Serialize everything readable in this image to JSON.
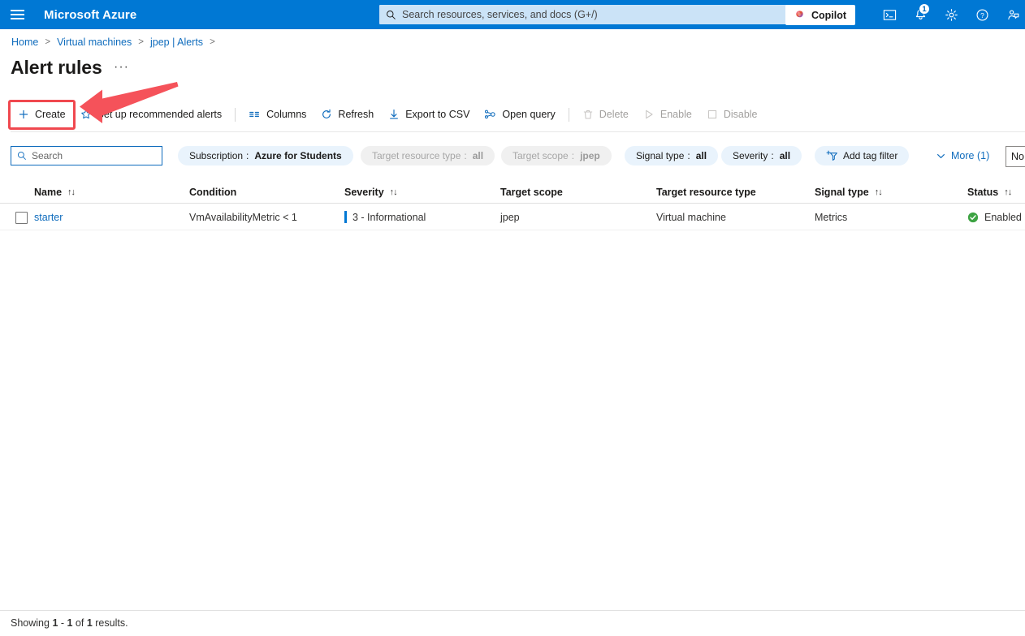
{
  "topbar": {
    "menu_icon": "hamburger-icon",
    "brand": "Microsoft Azure",
    "search_placeholder": "Search resources, services, and docs (G+/)",
    "search_icon": "search-icon",
    "copilot_label": "Copilot",
    "copilot_icon": "copilot-icon",
    "icons": [
      {
        "name": "cloud-shell-icon",
        "glyph": ">_"
      },
      {
        "name": "notifications-icon",
        "glyph": "bell",
        "badge": "1"
      },
      {
        "name": "settings-gear-icon",
        "glyph": "gear"
      },
      {
        "name": "help-icon",
        "glyph": "?"
      },
      {
        "name": "feedback-icon",
        "glyph": "person-feedback"
      }
    ],
    "accent": "#0078d4"
  },
  "breadcrumb": {
    "items": [
      "Home",
      "Virtual machines",
      "jpep | Alerts"
    ],
    "separator": ">",
    "trailing_separator": ">"
  },
  "page": {
    "title": "Alert rules",
    "ellipsis": "···"
  },
  "toolbar": {
    "items": [
      {
        "label": "Create",
        "icon": "plus-icon",
        "disabled": false,
        "highlighted": true
      },
      {
        "label": "Set up recommended alerts",
        "icon": "star-icon",
        "disabled": false
      },
      {
        "label": "Columns",
        "icon": "columns-icon",
        "disabled": false
      },
      {
        "label": "Refresh",
        "icon": "refresh-icon",
        "disabled": false
      },
      {
        "label": "Export to CSV",
        "icon": "download-icon",
        "disabled": false
      },
      {
        "label": "Open query",
        "icon": "open-query-icon",
        "disabled": false
      },
      {
        "label": "Delete",
        "icon": "trash-icon",
        "disabled": true
      },
      {
        "label": "Enable",
        "icon": "play-icon",
        "disabled": true
      },
      {
        "label": "Disable",
        "icon": "stop-square-icon",
        "disabled": true
      }
    ]
  },
  "annotation": {
    "color": "#f0484f",
    "target": "Create",
    "shape": "arrow-and-box"
  },
  "filters": {
    "search_placeholder": "Search",
    "search_value": "",
    "search_icon": "search-icon",
    "pills": [
      {
        "key": "Subscription",
        "value": "Azure for Students",
        "dim": false
      },
      {
        "key": "Target resource type",
        "value": "all",
        "dim": true
      },
      {
        "key": "Target scope",
        "value": "jpep",
        "dim": true
      },
      {
        "key": "Signal type",
        "value": "all",
        "dim": false
      },
      {
        "key": "Severity",
        "value": "all",
        "dim": false
      }
    ],
    "add_tag_filter": "Add tag filter",
    "add_tag_filter_icon": "add-filter-icon",
    "more_label": "More (1)",
    "more_icon": "chevron-down-icon",
    "timezone_value": "No"
  },
  "table": {
    "columns": [
      {
        "label": "Name",
        "sortable": true
      },
      {
        "label": "Condition",
        "sortable": false
      },
      {
        "label": "Severity",
        "sortable": true
      },
      {
        "label": "Target scope",
        "sortable": false
      },
      {
        "label": "Target resource type",
        "sortable": false
      },
      {
        "label": "Signal type",
        "sortable": true
      },
      {
        "label": "Status",
        "sortable": true
      }
    ],
    "sort_glyph": "↑↓",
    "rows": [
      {
        "name": "starter",
        "condition": "VmAvailabilityMetric < 1",
        "severity": "3 - Informational",
        "severity_color": "#0078d4",
        "target_scope": "jpep",
        "target_resource_type": "Virtual machine",
        "signal_type": "Metrics",
        "status": "Enabled",
        "status_icon": "check-circle-icon",
        "status_color": "#3da343",
        "checked": false
      }
    ]
  },
  "footer": {
    "text_prefix": "Showing ",
    "range_start": "1",
    "dash": " - ",
    "range_end": "1",
    "of": " of ",
    "total": "1",
    "suffix": " results."
  }
}
